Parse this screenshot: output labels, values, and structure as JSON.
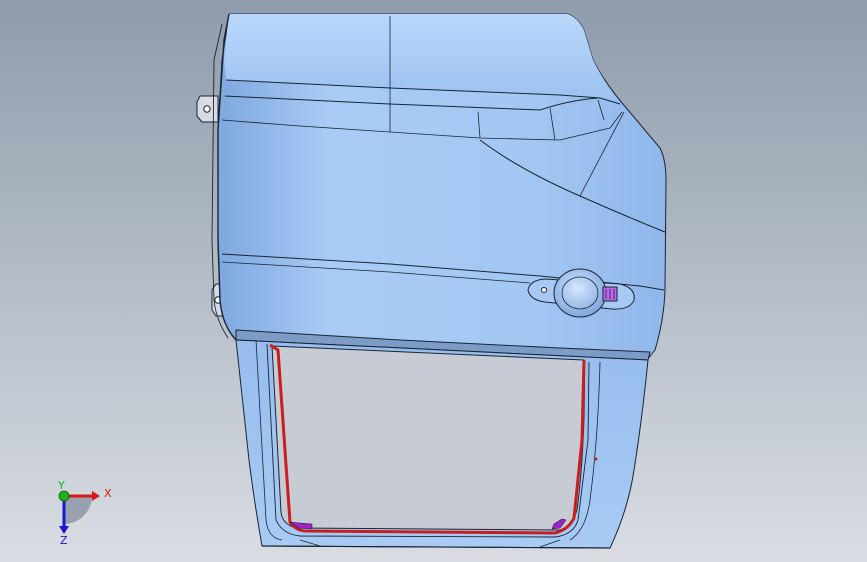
{
  "viewport": {
    "background_top": "#8f9cac",
    "background_bottom": "#d9dde3"
  },
  "model": {
    "panel_color": "#9ec3f2",
    "panel_highlight": "#bfd9fb",
    "panel_shadow": "#6f95c9",
    "edge_color": "#1a2433",
    "seal_color": "#c81e1e",
    "clip_color": "#a020c8"
  },
  "triad": {
    "x_label": "X",
    "y_label": "Y",
    "z_label": "Z",
    "x_color": "#d81818",
    "y_color": "#18b418",
    "z_color": "#1818d8"
  }
}
